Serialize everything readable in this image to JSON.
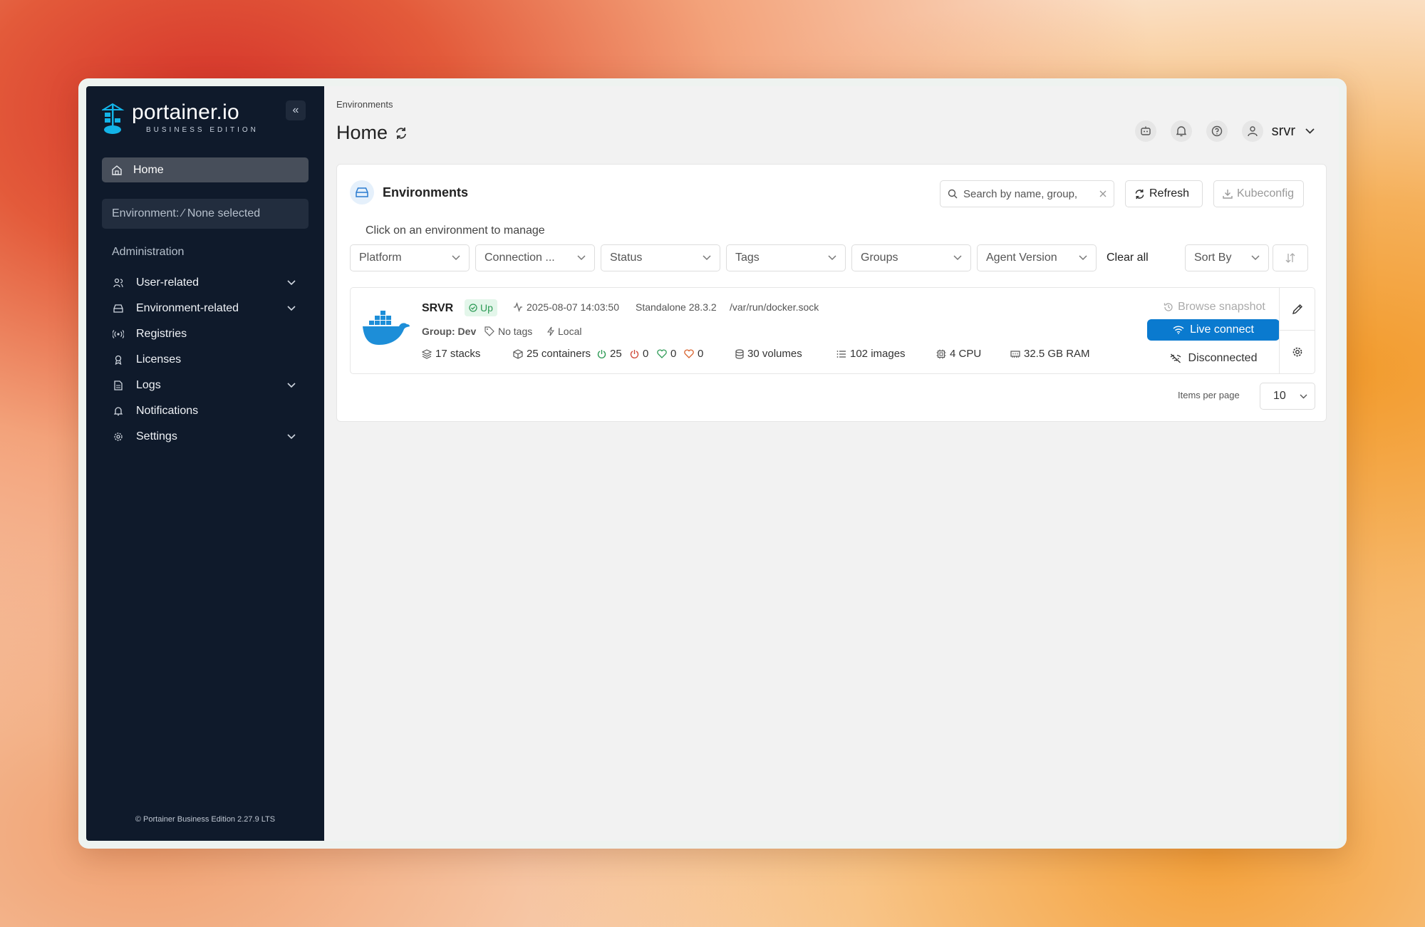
{
  "sidebar": {
    "logo_name": "portainer.io",
    "logo_sub": "BUSINESS EDITION",
    "collapse_glyph": "«",
    "home_label": "Home",
    "environment_label": "Environment: ⁄ None selected",
    "section_title": "Administration",
    "items": [
      {
        "label": "User-related",
        "icon": "users-icon",
        "has_chevron": true
      },
      {
        "label": "Environment-related",
        "icon": "server-icon",
        "has_chevron": true
      },
      {
        "label": "Registries",
        "icon": "radio-icon",
        "has_chevron": false
      },
      {
        "label": "Licenses",
        "icon": "award-icon",
        "has_chevron": false
      },
      {
        "label": "Logs",
        "icon": "file-icon",
        "has_chevron": true
      },
      {
        "label": "Notifications",
        "icon": "bell-icon",
        "has_chevron": false
      },
      {
        "label": "Settings",
        "icon": "gear-icon",
        "has_chevron": true
      }
    ],
    "footer": "© Portainer Business Edition 2.27.9 LTS"
  },
  "header": {
    "breadcrumb": "Environments",
    "title": "Home",
    "user": "srvr"
  },
  "card": {
    "title": "Environments",
    "search_placeholder": "Search by name, group,",
    "refresh_label": "Refresh",
    "kubeconfig_label": "Kubeconfig",
    "hint": "Click on an environment to manage",
    "filters": [
      "Platform",
      "Connection ...",
      "Status",
      "Tags",
      "Groups",
      "Agent Version"
    ],
    "clear_all": "Clear all",
    "sort_by": "Sort By",
    "items_per_page_label": "Items per page",
    "items_per_page": "10"
  },
  "environment": {
    "name": "SRVR",
    "status": "Up",
    "timestamp": "2025-08-07 14:03:50",
    "type": "Standalone 28.3.2",
    "socket": "/var/run/docker.sock",
    "group": "Group: Dev",
    "tags": "No tags",
    "location": "Local",
    "stacks": "17 stacks",
    "containers": "25 containers",
    "running": "25",
    "stopped": "0",
    "healthy": "0",
    "unhealthy": "0",
    "volumes": "30 volumes",
    "images": "102 images",
    "cpu": "4 CPU",
    "ram": "32.5 GB RAM",
    "browse_snapshot": "Browse snapshot",
    "live_connect": "Live connect",
    "connection_status": "Disconnected"
  },
  "colors": {
    "sidebar_bg": "#0f1a2b",
    "accent": "#0a7acf",
    "status_up": "#2e9b56"
  }
}
